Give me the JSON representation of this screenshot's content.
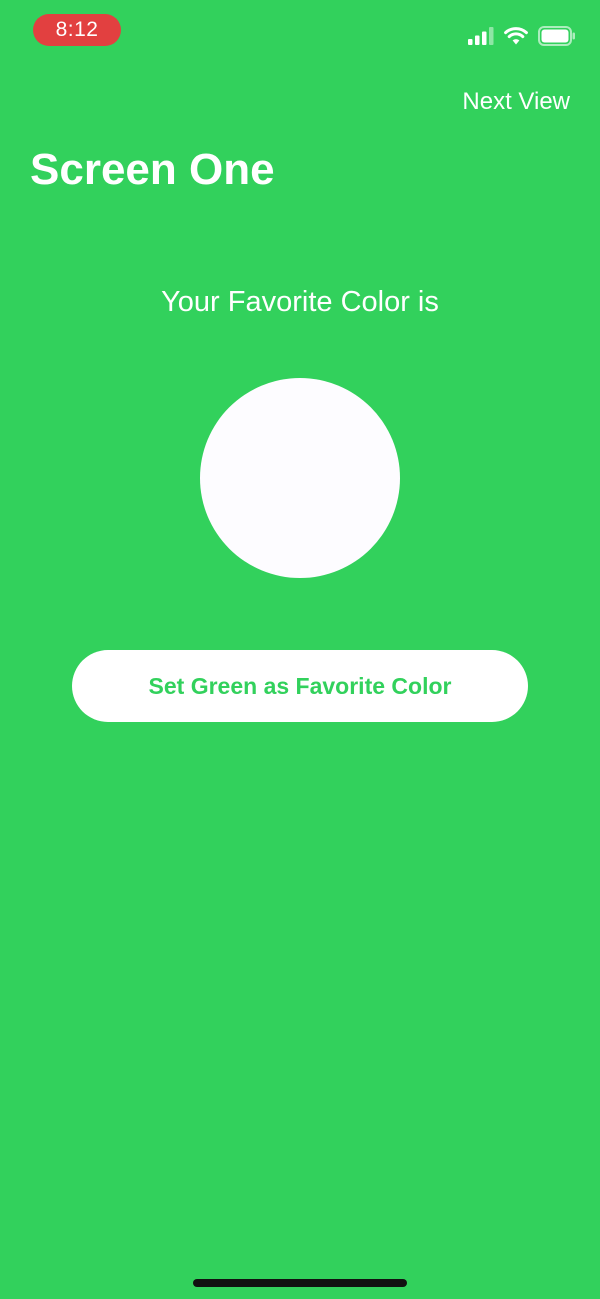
{
  "status_bar": {
    "time": "8:12",
    "icons": [
      "cellular-signal-icon",
      "wifi-icon",
      "battery-icon"
    ]
  },
  "nav": {
    "next_label": "Next View"
  },
  "screen": {
    "title": "Screen One",
    "subtitle": "Your Favorite Color is",
    "favorite_color": "#fdfcff",
    "button_label": "Set Green as Favorite Color"
  },
  "colors": {
    "background": "#32d15c",
    "accent": "#32d15c",
    "time_pill": "#e24040",
    "text": "#ffffff"
  }
}
